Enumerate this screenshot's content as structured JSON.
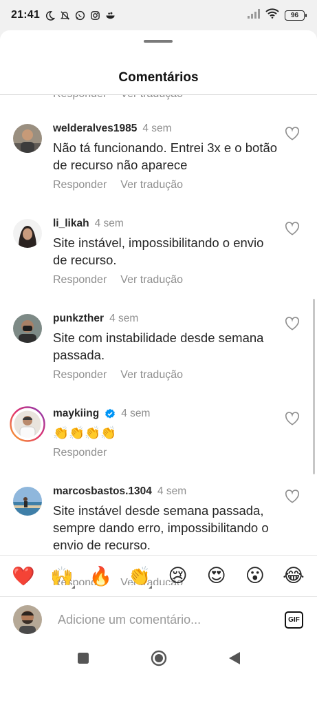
{
  "status_bar": {
    "time": "21:41",
    "battery": "96"
  },
  "sheet": {
    "title": "Comentários"
  },
  "labels": {
    "reply": "Responder",
    "translate": "Ver tradução"
  },
  "comments": [
    {
      "username": "welderalves1985",
      "time": "4 sem",
      "text": "Não tá funcionando. Entrei 3x e o botão de recurso não aparece",
      "show_translate": true
    },
    {
      "username": "li_likah",
      "time": "4 sem",
      "text": "Site instável, impossibilitando o envio de recurso.",
      "show_translate": true
    },
    {
      "username": "punkzther",
      "time": "4 sem",
      "text": "Site com instabilidade desde semana passada.",
      "show_translate": true
    },
    {
      "username": "maykiing",
      "time": "4 sem",
      "text": "👏👏👏👏",
      "verified": true,
      "show_translate": false
    },
    {
      "username": "marcosbastos.1304",
      "time": "4 sem",
      "text": "Site instável desde semana passada, sempre dando erro, impossibilitando o envio de recurso.",
      "show_translate": true
    }
  ],
  "emoji_bar": [
    "❤️",
    "🙌",
    "🔥",
    "👏",
    "😢",
    "😍",
    "😮",
    "😂"
  ],
  "input": {
    "placeholder": "Adicione um comentário...",
    "gif_label": "GIF"
  },
  "colors": {
    "secondary_text": "#8e8e8e",
    "verified_blue": "#0095f6",
    "story_ring": "#e1306c"
  }
}
